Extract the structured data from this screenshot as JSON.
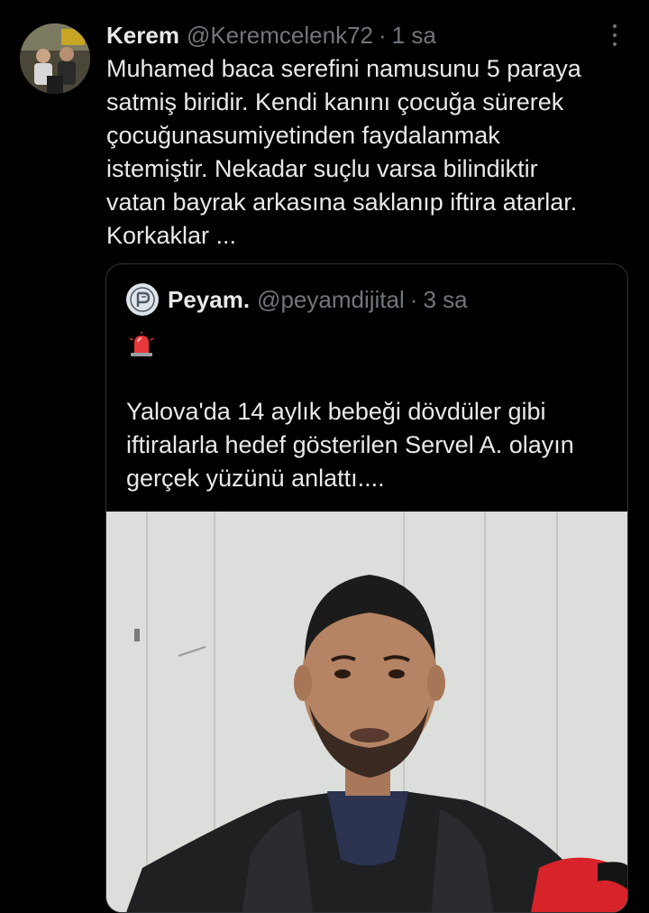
{
  "tweet": {
    "display_name": "Kerem",
    "handle": "@Keremcelenk72",
    "separator": "·",
    "time": "1 sa",
    "text": "Muhamed baca serefini namusunu 5 paraya\nsatmiş biridir. Kendi kanını çocuğa sürerek\nçocuğunasumiyetinden faydalanmak\nistemiştir. Nekadar suçlu varsa bilindiktir\nvatan bayrak arkasına saklanıp iftira atarlar.\nKorkaklar ..."
  },
  "quoted": {
    "display_name": "Peyam.",
    "handle": "@peyamdijital",
    "separator": "·",
    "time": "3 sa",
    "emoji_icon": "police-siren-icon",
    "text": "Yalova'da 14 aylık bebeği dövdüler gibi\niftiralarla hedef gösterilen Servel A. olayın\ngerçek yüzünü anlattı...."
  },
  "colors": {
    "background": "#000000",
    "primary_text": "#e7e9ea",
    "secondary_text": "#71767b",
    "border": "#2f3336"
  }
}
